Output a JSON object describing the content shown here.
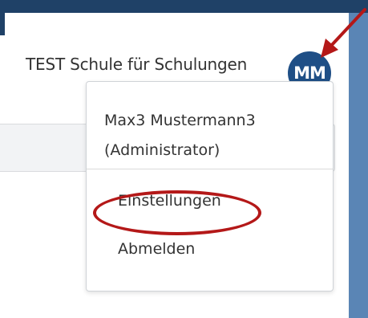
{
  "header": {
    "school_name": "TEST Schule für Schulungen",
    "avatar_initials": "MM"
  },
  "user_menu": {
    "user_name": "Max3 Mustermann3",
    "user_role": "(Administrator)",
    "items": [
      {
        "label": "Einstellungen",
        "highlighted": true
      },
      {
        "label": "Abmelden",
        "highlighted": false
      }
    ]
  },
  "colors": {
    "annotation": "#b41818",
    "avatar_bg": "#1f4f86",
    "nav_bar": "#1f4167",
    "page_bg": "#5a85b5"
  }
}
